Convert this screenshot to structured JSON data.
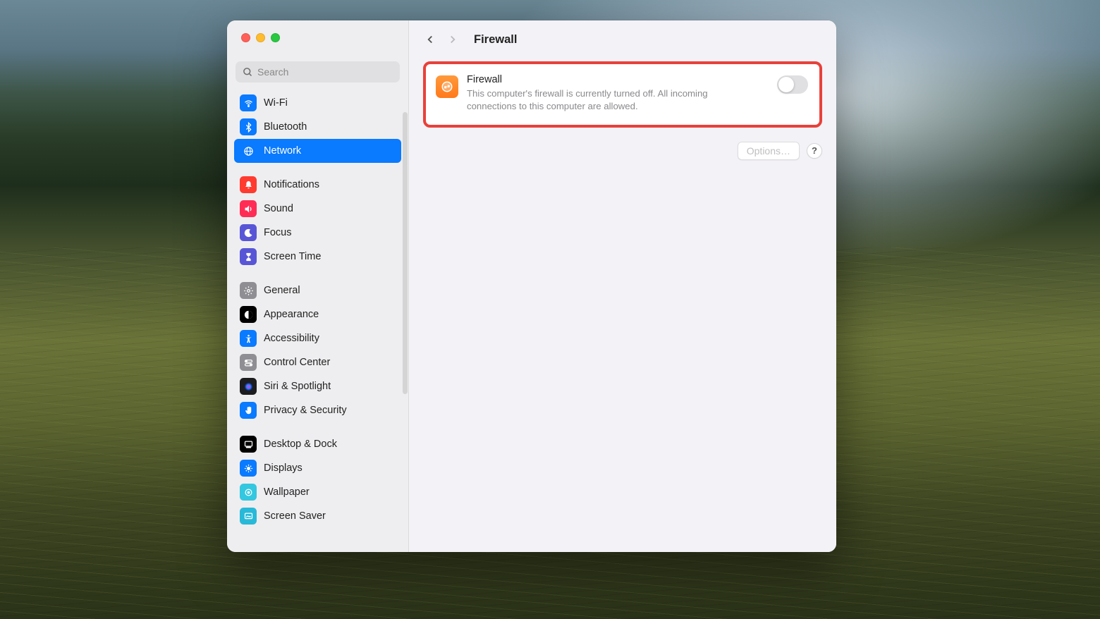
{
  "search": {
    "placeholder": "Search"
  },
  "sidebar": {
    "groups": [
      {
        "items": [
          {
            "label": "Wi-Fi",
            "icon": "wifi",
            "color": "#0a7aff"
          },
          {
            "label": "Bluetooth",
            "icon": "bluetooth",
            "color": "#0a7aff"
          },
          {
            "label": "Network",
            "icon": "network",
            "color": "#0a7aff",
            "selected": true
          }
        ]
      },
      {
        "items": [
          {
            "label": "Notifications",
            "icon": "bell",
            "color": "#ff3b30"
          },
          {
            "label": "Sound",
            "icon": "sound",
            "color": "#ff2d55"
          },
          {
            "label": "Focus",
            "icon": "focus",
            "color": "#5856d6"
          },
          {
            "label": "Screen Time",
            "icon": "hourglass",
            "color": "#5856d6"
          }
        ]
      },
      {
        "items": [
          {
            "label": "General",
            "icon": "gear",
            "color": "#8e8e93"
          },
          {
            "label": "Appearance",
            "icon": "appearance",
            "color": "#000000"
          },
          {
            "label": "Accessibility",
            "icon": "accessibility",
            "color": "#0a7aff"
          },
          {
            "label": "Control Center",
            "icon": "switches",
            "color": "#8e8e93"
          },
          {
            "label": "Siri & Spotlight",
            "icon": "siri",
            "color": "#1c1c1e"
          },
          {
            "label": "Privacy & Security",
            "icon": "hand",
            "color": "#0a7aff"
          }
        ]
      },
      {
        "items": [
          {
            "label": "Desktop & Dock",
            "icon": "dock",
            "color": "#000000"
          },
          {
            "label": "Displays",
            "icon": "displays",
            "color": "#0a7aff"
          },
          {
            "label": "Wallpaper",
            "icon": "wallpaper",
            "color": "#34c7e0"
          },
          {
            "label": "Screen Saver",
            "icon": "screensaver",
            "color": "#28b9d8"
          }
        ]
      }
    ]
  },
  "main": {
    "title": "Firewall",
    "card": {
      "title": "Firewall",
      "desc": "This computer's firewall is currently turned off. All incoming connections to this computer are allowed.",
      "toggle_on": false
    },
    "options_label": "Options…",
    "help_label": "?"
  },
  "colors": {
    "highlight": "#e8413a",
    "selection": "#0a7aff"
  }
}
